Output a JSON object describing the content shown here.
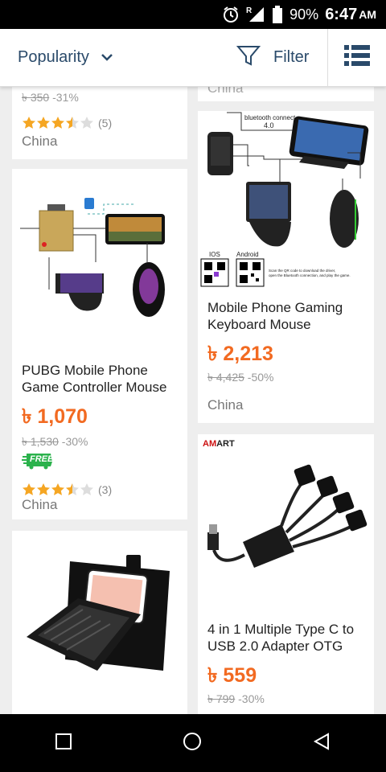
{
  "status": {
    "battery": "90%",
    "time": "6:47",
    "ampm": "AM"
  },
  "toolbar": {
    "sort_label": "Popularity",
    "filter_label": "Filter"
  },
  "products": [
    {
      "title": "",
      "price": "",
      "original_price": "৳ 350",
      "discount": "-31%",
      "rating": 3.5,
      "reviews": "(5)",
      "location": "China"
    },
    {
      "title": "",
      "price": "",
      "original_price": "",
      "discount": "",
      "location": "China"
    },
    {
      "title": "PUBG Mobile Phone Game Controller Mouse",
      "price": "৳ 1,070",
      "original_price": "৳ 1,530",
      "discount": "-30%",
      "badge": "FREE",
      "rating": 3.5,
      "reviews": "(3)",
      "location": "China"
    },
    {
      "title": "Mobile Phone Gaming Keyboard Mouse",
      "price": "৳ 2,213",
      "original_price": "৳ 4,425",
      "discount": "-50%",
      "location": "China",
      "image_text": {
        "bt": "bluetooth connect",
        "ver": "4.0",
        "ios": "IOS",
        "android": "Android",
        "caption1": "Scan the QR code to download the driver,",
        "caption2": "open the Bluetooth connection, and play the game."
      }
    },
    {
      "title": "",
      "price": ""
    },
    {
      "brand_a": "AM",
      "brand_b": "ART",
      "title": "4 in 1 Multiple Type C to USB 2.0 Adapter OTG",
      "price": "৳ 559",
      "original_price": "৳ 799",
      "discount": "-30%"
    }
  ],
  "colors": {
    "accent": "#f26a21",
    "star": "#f5a623",
    "free_badge": "#2bb24c"
  }
}
